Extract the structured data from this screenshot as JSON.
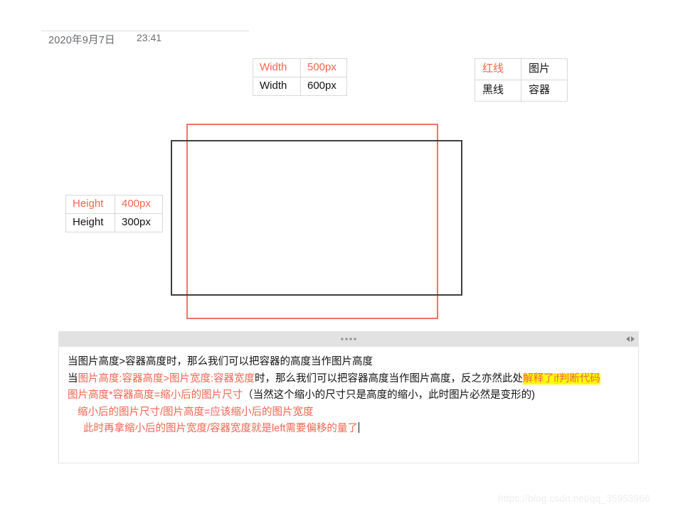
{
  "header": {
    "date": "2020年9月7日",
    "time": "23:41"
  },
  "tables": {
    "width_table": {
      "rows": [
        {
          "label": "Width",
          "value": "500px",
          "color": "#f2654f"
        },
        {
          "label": "Width",
          "value": "600px",
          "color": "#121212"
        }
      ]
    },
    "legend_table": {
      "rows": [
        {
          "label": "红线",
          "value": "图片",
          "color": "#f2654f"
        },
        {
          "label": "黑线",
          "value": "容器",
          "color": "#121212"
        }
      ]
    },
    "height_table": {
      "rows": [
        {
          "label": "Height",
          "value": "400px",
          "color": "#f2654f"
        },
        {
          "label": "Height",
          "value": "300px",
          "color": "#121212"
        }
      ]
    }
  },
  "diagram": {
    "image_rect_color": "#f4706b",
    "container_rect_color": "#3f3f3f"
  },
  "note_panel": {
    "lines": [
      {
        "segments": [
          {
            "text": "当图片高度>容器高度时，那么我们可以把容器的高度当作图片高度",
            "style": "black"
          }
        ]
      },
      {
        "segments": [
          {
            "text": "当",
            "style": "black"
          },
          {
            "text": "图片高度:容器高度>图片宽度:容器宽度",
            "style": "red"
          },
          {
            "text": "时，那么我们可以把容器高度当作图片高度，反之亦然此处",
            "style": "black"
          },
          {
            "text": "解释了if判断代码",
            "style": "highlight"
          }
        ]
      },
      {
        "segments": [
          {
            "text": "图片高度*容器高度=缩小后的图片尺寸",
            "style": "red"
          },
          {
            "text": "（当然这个缩小的尺寸只是高度的缩小，此时图片必然是变形的)",
            "style": "black"
          }
        ]
      },
      {
        "segments": [
          {
            "text": "缩小后的图片尺寸/图片高度=应该缩小后的图片宽度",
            "style": "red"
          }
        ]
      },
      {
        "segments": [
          {
            "text": "此时再拿缩小后的图片宽度/容器宽度就是left需要偏移的量了",
            "style": "red"
          }
        ]
      }
    ]
  },
  "watermark": {
    "text": "https://blog.csdn.net/qq_35953966"
  }
}
